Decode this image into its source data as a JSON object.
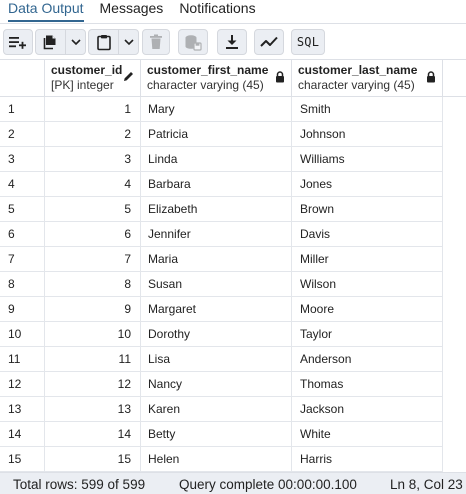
{
  "tabs": [
    {
      "label": "Data Output",
      "active": true
    },
    {
      "label": "Messages",
      "active": false
    },
    {
      "label": "Notifications",
      "active": false
    }
  ],
  "toolbar": {
    "buttons": [
      {
        "name": "add-row-button",
        "icon": "add-row-icon",
        "dropdown": false
      },
      {
        "name": "copy-button",
        "icon": "copy-icon",
        "dropdown": true
      },
      {
        "name": "paste-button",
        "icon": "paste-icon",
        "dropdown": true
      },
      {
        "name": "delete-button",
        "icon": "trash-icon",
        "disabled": true
      },
      {
        "name": "save-data-button",
        "icon": "database-save-icon",
        "disabled": true
      },
      {
        "name": "download-button",
        "icon": "download-icon"
      },
      {
        "name": "graph-visualiser-button",
        "icon": "line-graph-icon"
      },
      {
        "name": "sql-button",
        "label": "SQL"
      }
    ],
    "sql_label": "SQL"
  },
  "columns": [
    {
      "name": "customer_id",
      "type": "[PK] integer",
      "icon": "pencil-icon"
    },
    {
      "name": "customer_first_name",
      "type": "character varying (45)",
      "icon": "lock-icon"
    },
    {
      "name": "customer_last_name",
      "type": "character varying (45)",
      "icon": "lock-icon"
    }
  ],
  "rows": [
    {
      "n": "1",
      "id": "1",
      "first": "Mary",
      "last": "Smith"
    },
    {
      "n": "2",
      "id": "2",
      "first": "Patricia",
      "last": "Johnson"
    },
    {
      "n": "3",
      "id": "3",
      "first": "Linda",
      "last": "Williams"
    },
    {
      "n": "4",
      "id": "4",
      "first": "Barbara",
      "last": "Jones"
    },
    {
      "n": "5",
      "id": "5",
      "first": "Elizabeth",
      "last": "Brown"
    },
    {
      "n": "6",
      "id": "6",
      "first": "Jennifer",
      "last": "Davis"
    },
    {
      "n": "7",
      "id": "7",
      "first": "Maria",
      "last": "Miller"
    },
    {
      "n": "8",
      "id": "8",
      "first": "Susan",
      "last": "Wilson"
    },
    {
      "n": "9",
      "id": "9",
      "first": "Margaret",
      "last": "Moore"
    },
    {
      "n": "10",
      "id": "10",
      "first": "Dorothy",
      "last": "Taylor"
    },
    {
      "n": "11",
      "id": "11",
      "first": "Lisa",
      "last": "Anderson"
    },
    {
      "n": "12",
      "id": "12",
      "first": "Nancy",
      "last": "Thomas"
    },
    {
      "n": "13",
      "id": "13",
      "first": "Karen",
      "last": "Jackson"
    },
    {
      "n": "14",
      "id": "14",
      "first": "Betty",
      "last": "White"
    },
    {
      "n": "15",
      "id": "15",
      "first": "Helen",
      "last": "Harris"
    }
  ],
  "status": {
    "total_rows": "Total rows: 599 of 599",
    "query": "Query complete 00:00:00.100",
    "position": "Ln 8, Col 23"
  },
  "colors": {
    "accent": "#326690",
    "toolbar_button_bg": "#ebeef3",
    "status_bg": "#ebeef3",
    "grid_line": "#dde0e6"
  }
}
